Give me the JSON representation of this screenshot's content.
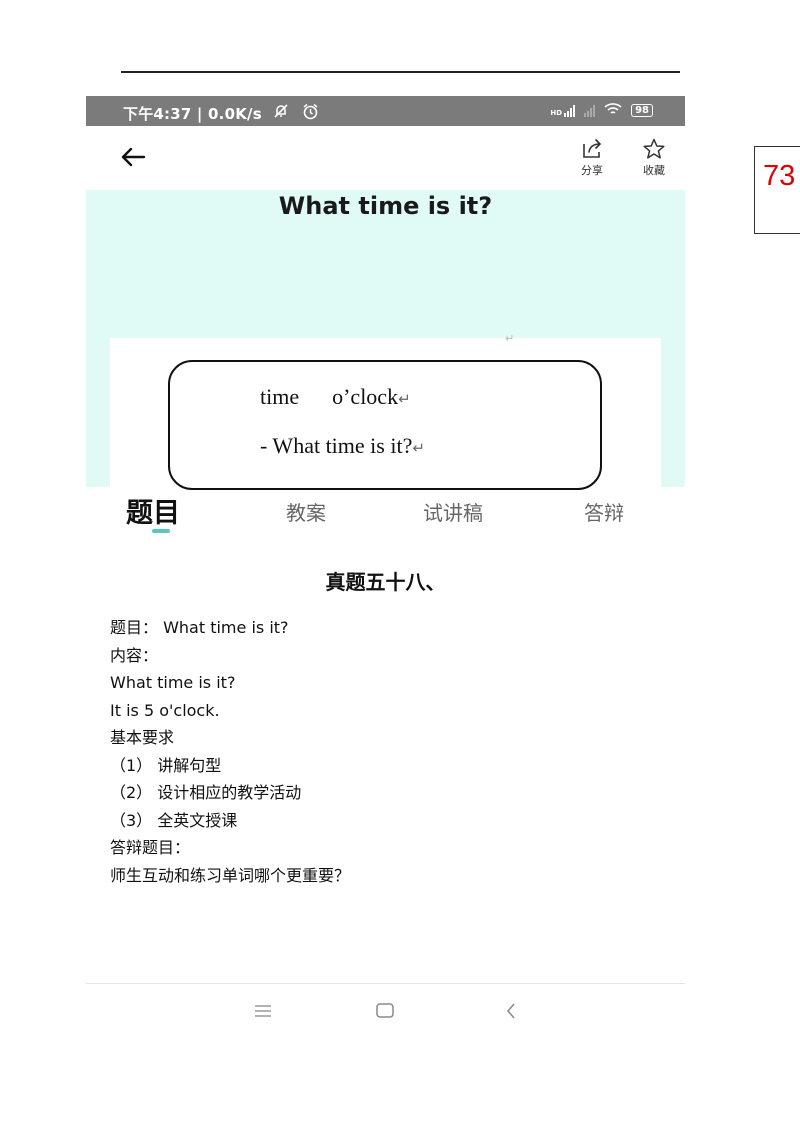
{
  "page_number": "73",
  "status_bar": {
    "time": "下午4:37 | 0.0K/s",
    "hd_label": "HD",
    "battery": "98",
    "icons": [
      "mute-bell-icon",
      "alarm-icon",
      "signal-icon",
      "wifi-icon",
      "battery-icon"
    ]
  },
  "app_bar": {
    "share_label": "分享",
    "favorite_label": "收藏"
  },
  "hero": {
    "title": "What time is it?",
    "line1": "time      o’clock",
    "line2": "- What time is it?",
    "return_mark": "↵"
  },
  "tabs": [
    {
      "label": "题目",
      "active": true
    },
    {
      "label": "教案",
      "active": false
    },
    {
      "label": "试讲稿",
      "active": false
    },
    {
      "label": "答辩",
      "active": false
    }
  ],
  "section_title": "真题五十八、",
  "content_lines": [
    "题目： What time is it?",
    "内容：",
    "What time is it?",
    "It is 5 o'clock.",
    "基本要求",
    "（1） 讲解句型",
    "（2） 设计相应的教学活动",
    "（3） 全英文授课",
    "答辩题目：",
    "师生互动和练习单词哪个更重要？"
  ],
  "colors": {
    "status_bar": "#7b7b7b",
    "hero_background": "#e0fbf6",
    "tab_indicator": "#5bc8c0",
    "page_number": "#e00000"
  }
}
